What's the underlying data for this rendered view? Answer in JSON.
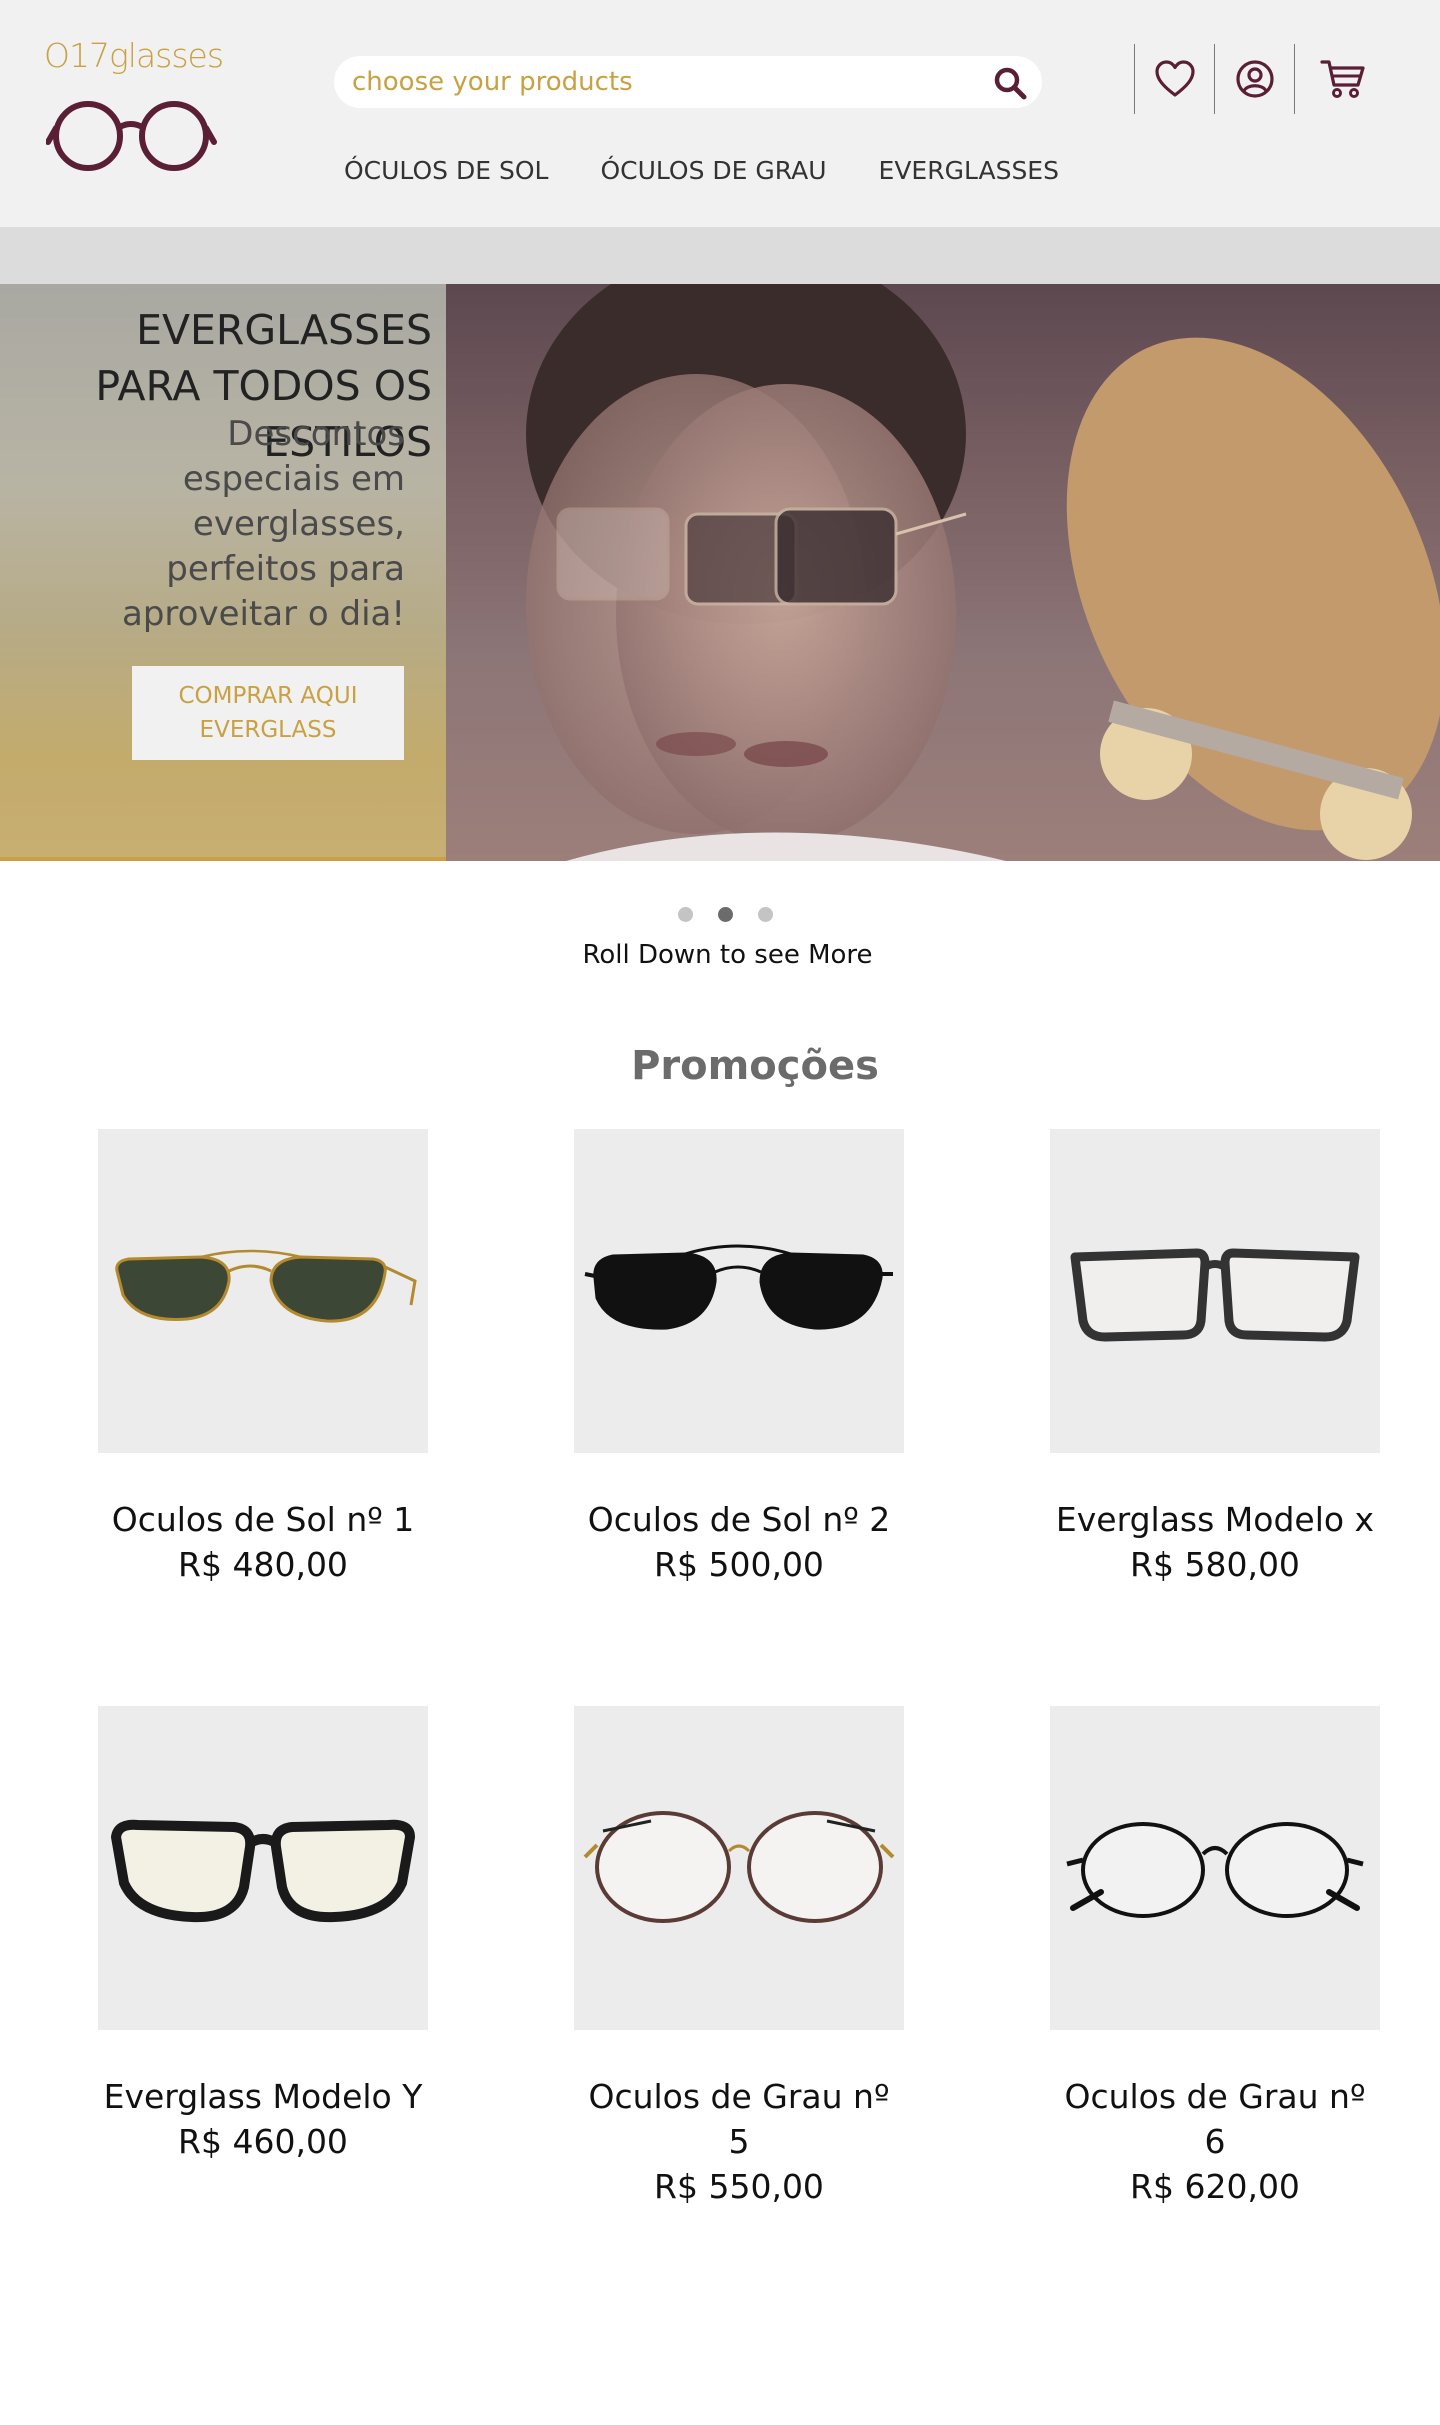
{
  "brand": {
    "logo_text": "O17glasses",
    "accent": "#c9a142",
    "dark_accent": "#5a1e35"
  },
  "search": {
    "placeholder": "choose your products"
  },
  "nav": {
    "items": [
      "ÓCULOS DE SOL",
      "ÓCULOS DE GRAU",
      "EVERGLASSES"
    ]
  },
  "header_icons": [
    "heart-icon",
    "user-icon",
    "cart-icon"
  ],
  "hero": {
    "title": "EVERGLASSES PARA TODOS OS ESTILOS",
    "subtitle": "Descontos especiais em everglasses, perfeitos para aproveitar o dia!",
    "cta": "COMPRAR AQUI EVERGLASS"
  },
  "carousel": {
    "slides": 3,
    "active": 2
  },
  "roll_text": "Roll Down to see More",
  "promo_title": "Promoções",
  "products": [
    {
      "name": "Oculos de Sol nº 1",
      "price": "R$ 480,00",
      "style": "aviator-green"
    },
    {
      "name": "Oculos de Sol nº 2",
      "price": "R$ 500,00",
      "style": "aviator-black"
    },
    {
      "name": "Everglass Modelo x",
      "price": "R$ 580,00",
      "style": "square-clear"
    },
    {
      "name": "Everglass Modelo Y",
      "price": "R$ 460,00",
      "style": "sport-clear"
    },
    {
      "name": "Oculos de Grau nº 5",
      "price": "R$ 550,00",
      "style": "round-thin"
    },
    {
      "name": "Oculos de Grau nº 6",
      "price": "R$ 620,00",
      "style": "round-black"
    }
  ]
}
